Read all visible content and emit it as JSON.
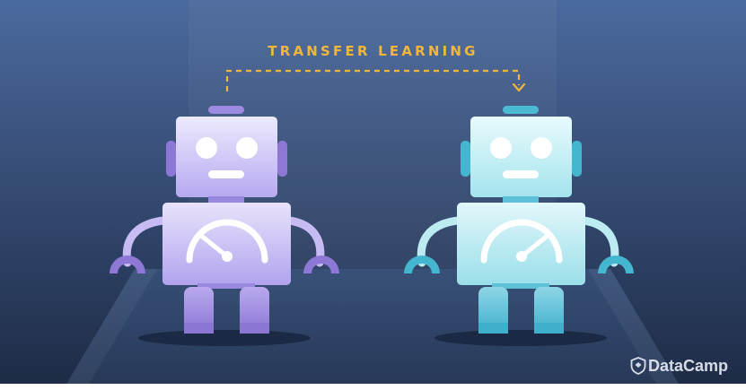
{
  "title": "TRANSFER LEARNING",
  "brand": {
    "name": "DataCamp",
    "icon": "datacamp-logo-icon"
  },
  "colors": {
    "background_top": "#4b6a9e",
    "background_bottom": "#1d2a44",
    "accent": "#f2b63b",
    "robot_left_primary": "#a99be6",
    "robot_left_dark": "#8d78d6",
    "robot_right_primary": "#a9e6ef",
    "robot_right_dark": "#45b6cf"
  },
  "icons": [
    "gauge-icon",
    "arrow-down-icon"
  ]
}
